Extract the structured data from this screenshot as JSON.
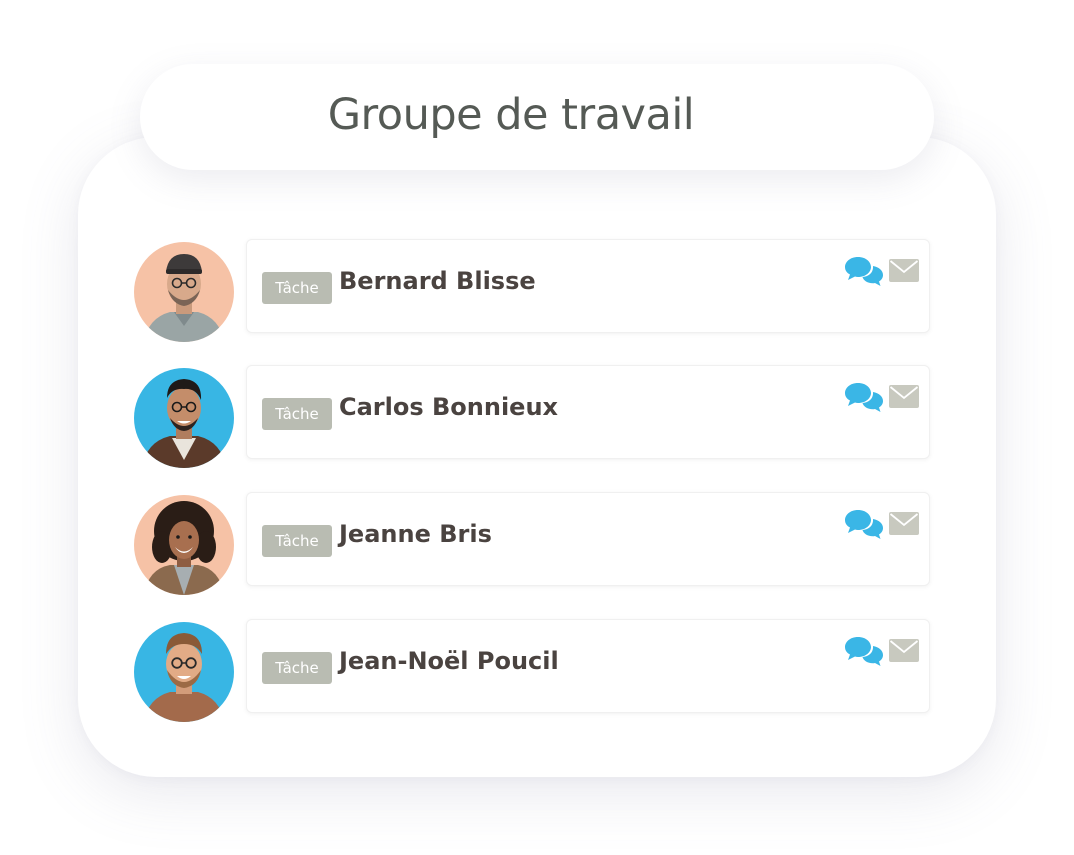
{
  "title": "Groupe de travail",
  "members": [
    {
      "badge": "Tâche",
      "name": "Bernard Blisse",
      "avatar_bg": "#f6c2a6"
    },
    {
      "badge": "Tâche",
      "name": "Carlos Bonnieux",
      "avatar_bg": "#38b6e4"
    },
    {
      "badge": "Tâche",
      "name": "Jeanne Bris",
      "avatar_bg": "#f6c2a6"
    },
    {
      "badge": "Tâche",
      "name": "Jean-Noël Poucil",
      "avatar_bg": "#38b6e4"
    }
  ],
  "icons": {
    "chat": "chat-bubbles-icon",
    "mail": "envelope-icon"
  },
  "colors": {
    "badge": "#b9bcb2",
    "chat_icon": "#3ab6e6",
    "mail_icon": "#c8c9bf",
    "name_text": "#4a4340",
    "title_text": "#555a55"
  }
}
